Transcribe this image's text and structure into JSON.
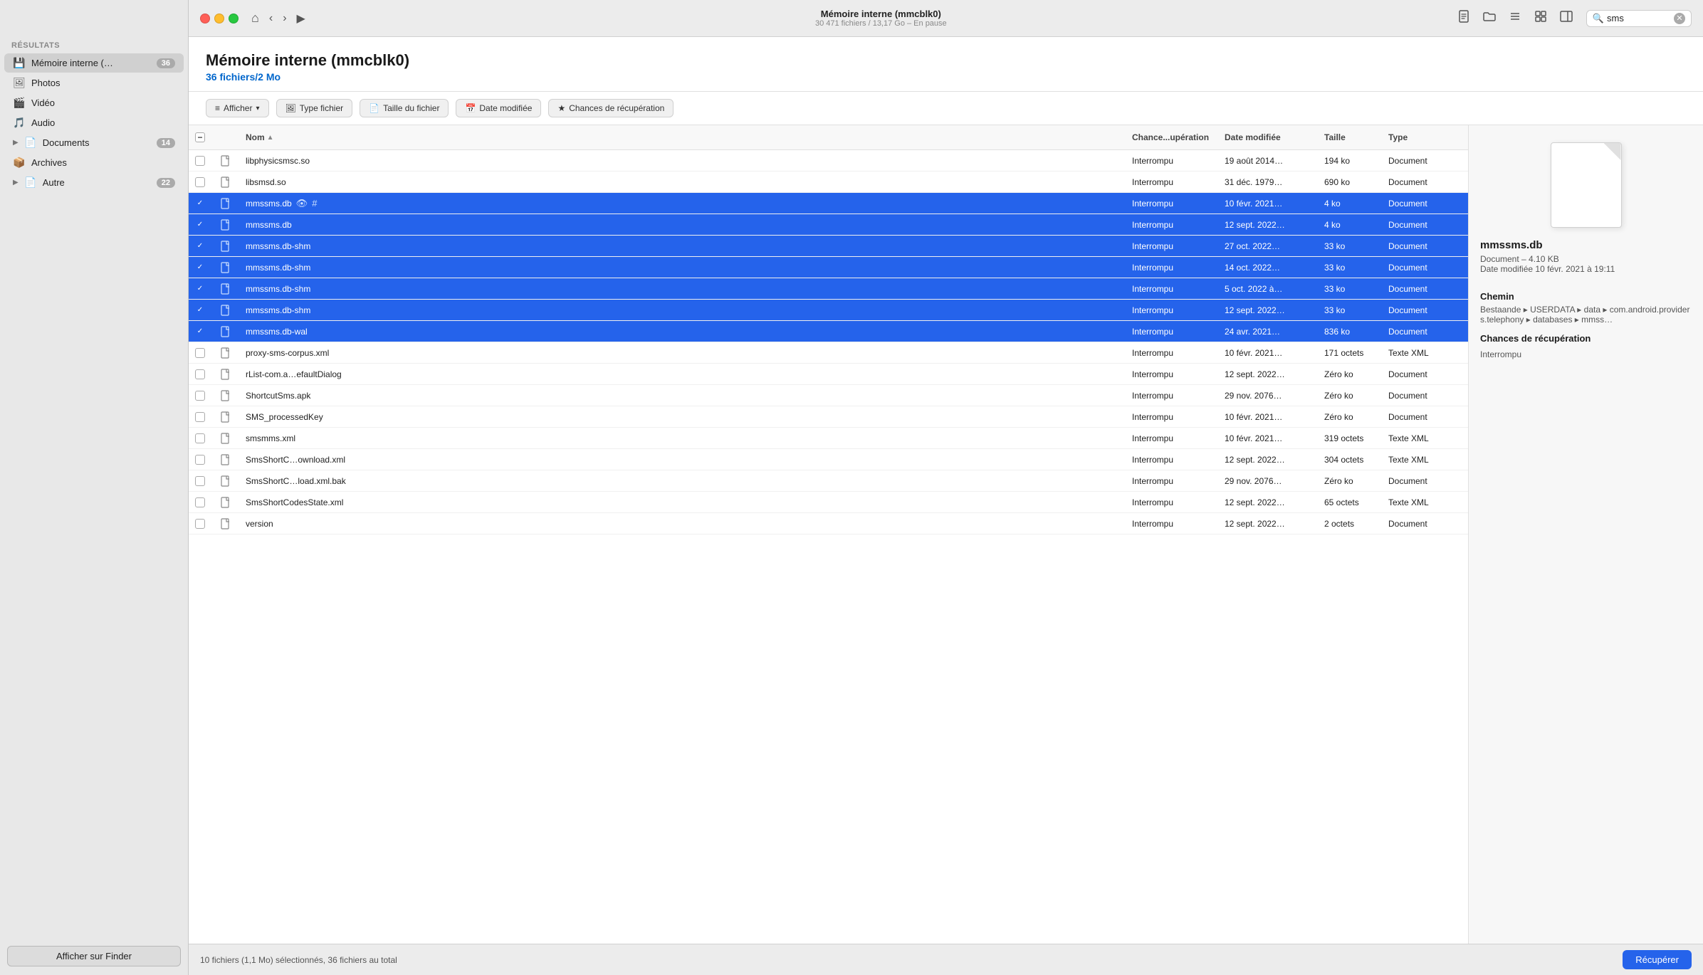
{
  "app": {
    "traffic_lights": [
      "close",
      "minimize",
      "maximize"
    ],
    "title": "Mémoire interne (mmcblk0)",
    "subtitle": "30 471 fichiers / 13,17 Go – En pause",
    "nav": {
      "back_label": "‹",
      "forward_label": "›",
      "home_label": "⌂",
      "play_label": "▶"
    },
    "toolbar": {
      "new_doc_label": "📄",
      "folder_label": "📁",
      "list_label": "☰",
      "grid_label": "⊞",
      "panel_label": "⬛"
    },
    "search": {
      "placeholder": "sms",
      "value": "sms"
    }
  },
  "sidebar": {
    "results_label": "Résultats",
    "items": [
      {
        "id": "memoire",
        "label": "Mémoire interne (…",
        "badge": "36",
        "icon": "💾",
        "active": true
      },
      {
        "id": "photos",
        "label": "Photos",
        "badge": "",
        "icon": "🖼",
        "active": false
      },
      {
        "id": "video",
        "label": "Vidéo",
        "badge": "",
        "icon": "🎬",
        "active": false
      },
      {
        "id": "audio",
        "label": "Audio",
        "badge": "",
        "icon": "🎵",
        "active": false
      },
      {
        "id": "documents",
        "label": "Documents",
        "badge": "14",
        "icon": "📄",
        "active": false,
        "expandable": true
      },
      {
        "id": "archives",
        "label": "Archives",
        "badge": "",
        "icon": "📦",
        "active": false
      },
      {
        "id": "autre",
        "label": "Autre",
        "badge": "22",
        "icon": "📄",
        "active": false,
        "expandable": true
      }
    ],
    "show_finder_label": "Afficher sur Finder"
  },
  "page": {
    "title": "Mémoire interne (mmcblk0)",
    "subtitle": "36 fichiers/2 Mo"
  },
  "filters": [
    {
      "id": "afficher",
      "label": "Afficher",
      "has_dropdown": true,
      "icon": "≡"
    },
    {
      "id": "type_fichier",
      "label": "Type fichier",
      "icon": "🖼"
    },
    {
      "id": "taille_fichier",
      "label": "Taille du fichier",
      "icon": "📄"
    },
    {
      "id": "date_modifiee",
      "label": "Date modifiée",
      "icon": "📅"
    },
    {
      "id": "chances_recuperation",
      "label": "Chances de récupération",
      "icon": "★"
    }
  ],
  "table": {
    "columns": [
      {
        "id": "checkbox",
        "label": ""
      },
      {
        "id": "icon",
        "label": ""
      },
      {
        "id": "nom",
        "label": "Nom",
        "sort": "asc"
      },
      {
        "id": "chances",
        "label": "Chance...upération"
      },
      {
        "id": "date_modifiee",
        "label": "Date modifiée"
      },
      {
        "id": "taille",
        "label": "Taille"
      },
      {
        "id": "type",
        "label": "Type"
      }
    ],
    "rows": [
      {
        "id": 1,
        "checked": false,
        "name": "libphysicsmsc.so",
        "chances": "Interrompu",
        "date": "19 août 2014…",
        "size": "194 ko",
        "type": "Document",
        "selected": false
      },
      {
        "id": 2,
        "checked": false,
        "name": "libsmsd.so",
        "chances": "Interrompu",
        "date": "31 déc. 1979…",
        "size": "690 ko",
        "type": "Document",
        "selected": false
      },
      {
        "id": 3,
        "checked": true,
        "name": "mmssms.db",
        "chances": "Interrompu",
        "date": "10 févr. 2021…",
        "size": "4 ko",
        "type": "Document",
        "selected": true,
        "has_eye": true,
        "has_hash": true
      },
      {
        "id": 4,
        "checked": true,
        "name": "mmssms.db",
        "chances": "Interrompu",
        "date": "12 sept. 2022…",
        "size": "4 ko",
        "type": "Document",
        "selected": true
      },
      {
        "id": 5,
        "checked": true,
        "name": "mmssms.db-shm",
        "chances": "Interrompu",
        "date": "27 oct. 2022…",
        "size": "33 ko",
        "type": "Document",
        "selected": true
      },
      {
        "id": 6,
        "checked": true,
        "name": "mmssms.db-shm",
        "chances": "Interrompu",
        "date": "14 oct. 2022…",
        "size": "33 ko",
        "type": "Document",
        "selected": true
      },
      {
        "id": 7,
        "checked": true,
        "name": "mmssms.db-shm",
        "chances": "Interrompu",
        "date": "5 oct. 2022 à…",
        "size": "33 ko",
        "type": "Document",
        "selected": true
      },
      {
        "id": 8,
        "checked": true,
        "name": "mmssms.db-shm",
        "chances": "Interrompu",
        "date": "12 sept. 2022…",
        "size": "33 ko",
        "type": "Document",
        "selected": true
      },
      {
        "id": 9,
        "checked": true,
        "name": "mmssms.db-wal",
        "chances": "Interrompu",
        "date": "24 avr. 2021…",
        "size": "836 ko",
        "type": "Document",
        "selected": true
      },
      {
        "id": 10,
        "checked": false,
        "name": "proxy-sms-corpus.xml",
        "chances": "Interrompu",
        "date": "10 févr. 2021…",
        "size": "171 octets",
        "type": "Texte XML",
        "selected": false
      },
      {
        "id": 11,
        "checked": false,
        "name": "rList-com.a…efaultDialog",
        "chances": "Interrompu",
        "date": "12 sept. 2022…",
        "size": "Zéro ko",
        "type": "Document",
        "selected": false
      },
      {
        "id": 12,
        "checked": false,
        "name": "ShortcutSms.apk",
        "chances": "Interrompu",
        "date": "29 nov. 2076…",
        "size": "Zéro ko",
        "type": "Document",
        "selected": false
      },
      {
        "id": 13,
        "checked": false,
        "name": "SMS_processedKey",
        "chances": "Interrompu",
        "date": "10 févr. 2021…",
        "size": "Zéro ko",
        "type": "Document",
        "selected": false
      },
      {
        "id": 14,
        "checked": false,
        "name": "smsmms.xml",
        "chances": "Interrompu",
        "date": "10 févr. 2021…",
        "size": "319 octets",
        "type": "Texte XML",
        "selected": false
      },
      {
        "id": 15,
        "checked": false,
        "name": "SmsShortC…ownload.xml",
        "chances": "Interrompu",
        "date": "12 sept. 2022…",
        "size": "304 octets",
        "type": "Texte XML",
        "selected": false
      },
      {
        "id": 16,
        "checked": false,
        "name": "SmsShortC…load.xml.bak",
        "chances": "Interrompu",
        "date": "29 nov. 2076…",
        "size": "Zéro ko",
        "type": "Document",
        "selected": false
      },
      {
        "id": 17,
        "checked": false,
        "name": "SmsShortCodesState.xml",
        "chances": "Interrompu",
        "date": "12 sept. 2022…",
        "size": "65 octets",
        "type": "Texte XML",
        "selected": false
      },
      {
        "id": 18,
        "checked": false,
        "name": "version",
        "chances": "Interrompu",
        "date": "12 sept. 2022…",
        "size": "2 octets",
        "type": "Document",
        "selected": false
      }
    ]
  },
  "detail": {
    "filename": "mmssms.db",
    "meta": "Document – 4.10 KB",
    "date_label": "Date modifiée",
    "date_value": "10 févr. 2021 à 19:11",
    "path_label": "Chemin",
    "path_value": "Bestaande ▸ USERDATA ▸ data ▸ com.android.providers.telephony ▸ databases ▸ mmss…",
    "recovery_label": "Chances de récupération",
    "recovery_value": "Interrompu"
  },
  "statusbar": {
    "info": "10 fichiers (1,1 Mo) sélectionnés, 36 fichiers au total",
    "recover_label": "Récupérer"
  }
}
